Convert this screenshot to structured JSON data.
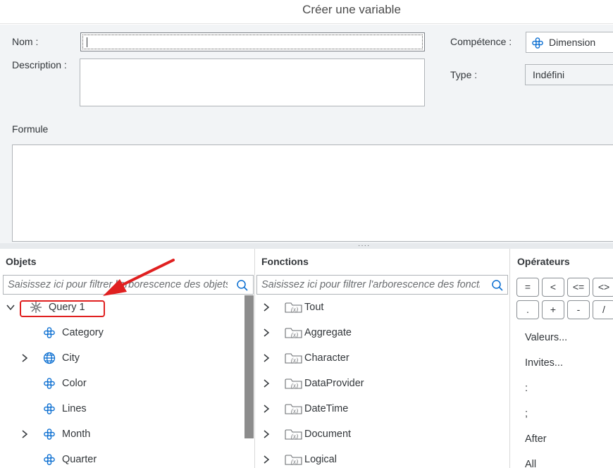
{
  "dialog": {
    "title": "Créer une variable"
  },
  "form": {
    "name_label": "Nom :",
    "name_value": "",
    "description_label": "Description :",
    "description_value": "",
    "competence_label": "Compétence :",
    "competence_value": "Dimension",
    "type_label": "Type :",
    "type_value": "Indéfini",
    "formula_label": "Formule"
  },
  "objects_panel": {
    "title": "Objets",
    "search_placeholder": "Saisissez ici pour filtrer l'arborescence des objets",
    "tree": {
      "root": {
        "label": "Query 1",
        "icon": "query-icon",
        "expanded": true
      },
      "items": [
        {
          "label": "Category",
          "icon": "dimension-icon",
          "expandable": false
        },
        {
          "label": "City",
          "icon": "globe-icon",
          "expandable": true
        },
        {
          "label": "Color",
          "icon": "dimension-icon",
          "expandable": false
        },
        {
          "label": "Lines",
          "icon": "dimension-icon",
          "expandable": false
        },
        {
          "label": "Month",
          "icon": "dimension-icon",
          "expandable": true
        },
        {
          "label": "Quarter",
          "icon": "dimension-icon",
          "expandable": false
        }
      ]
    }
  },
  "functions_panel": {
    "title": "Fonctions",
    "search_placeholder": "Saisissez ici pour filtrer l'arborescence des fonctions",
    "items": [
      {
        "label": "Tout",
        "icon": "function-folder-icon"
      },
      {
        "label": "Aggregate",
        "icon": "function-folder-icon"
      },
      {
        "label": "Character",
        "icon": "function-folder-icon"
      },
      {
        "label": "DataProvider",
        "icon": "function-folder-icon"
      },
      {
        "label": "DateTime",
        "icon": "function-folder-icon"
      },
      {
        "label": "Document",
        "icon": "function-folder-icon"
      },
      {
        "label": "Logical",
        "icon": "function-folder-icon"
      }
    ]
  },
  "operators_panel": {
    "title": "Opérateurs",
    "buttons_row1": [
      "=",
      "<",
      "<=",
      "<>"
    ],
    "buttons_row2": [
      ".",
      "+",
      "-",
      "/"
    ],
    "items": [
      "Valeurs...",
      "Invites...",
      ":",
      ";",
      "After",
      "All"
    ]
  },
  "colors": {
    "form_background": "#f2f4f6",
    "accent_blue": "#0a6ed1",
    "annotation_red": "#e02020"
  }
}
